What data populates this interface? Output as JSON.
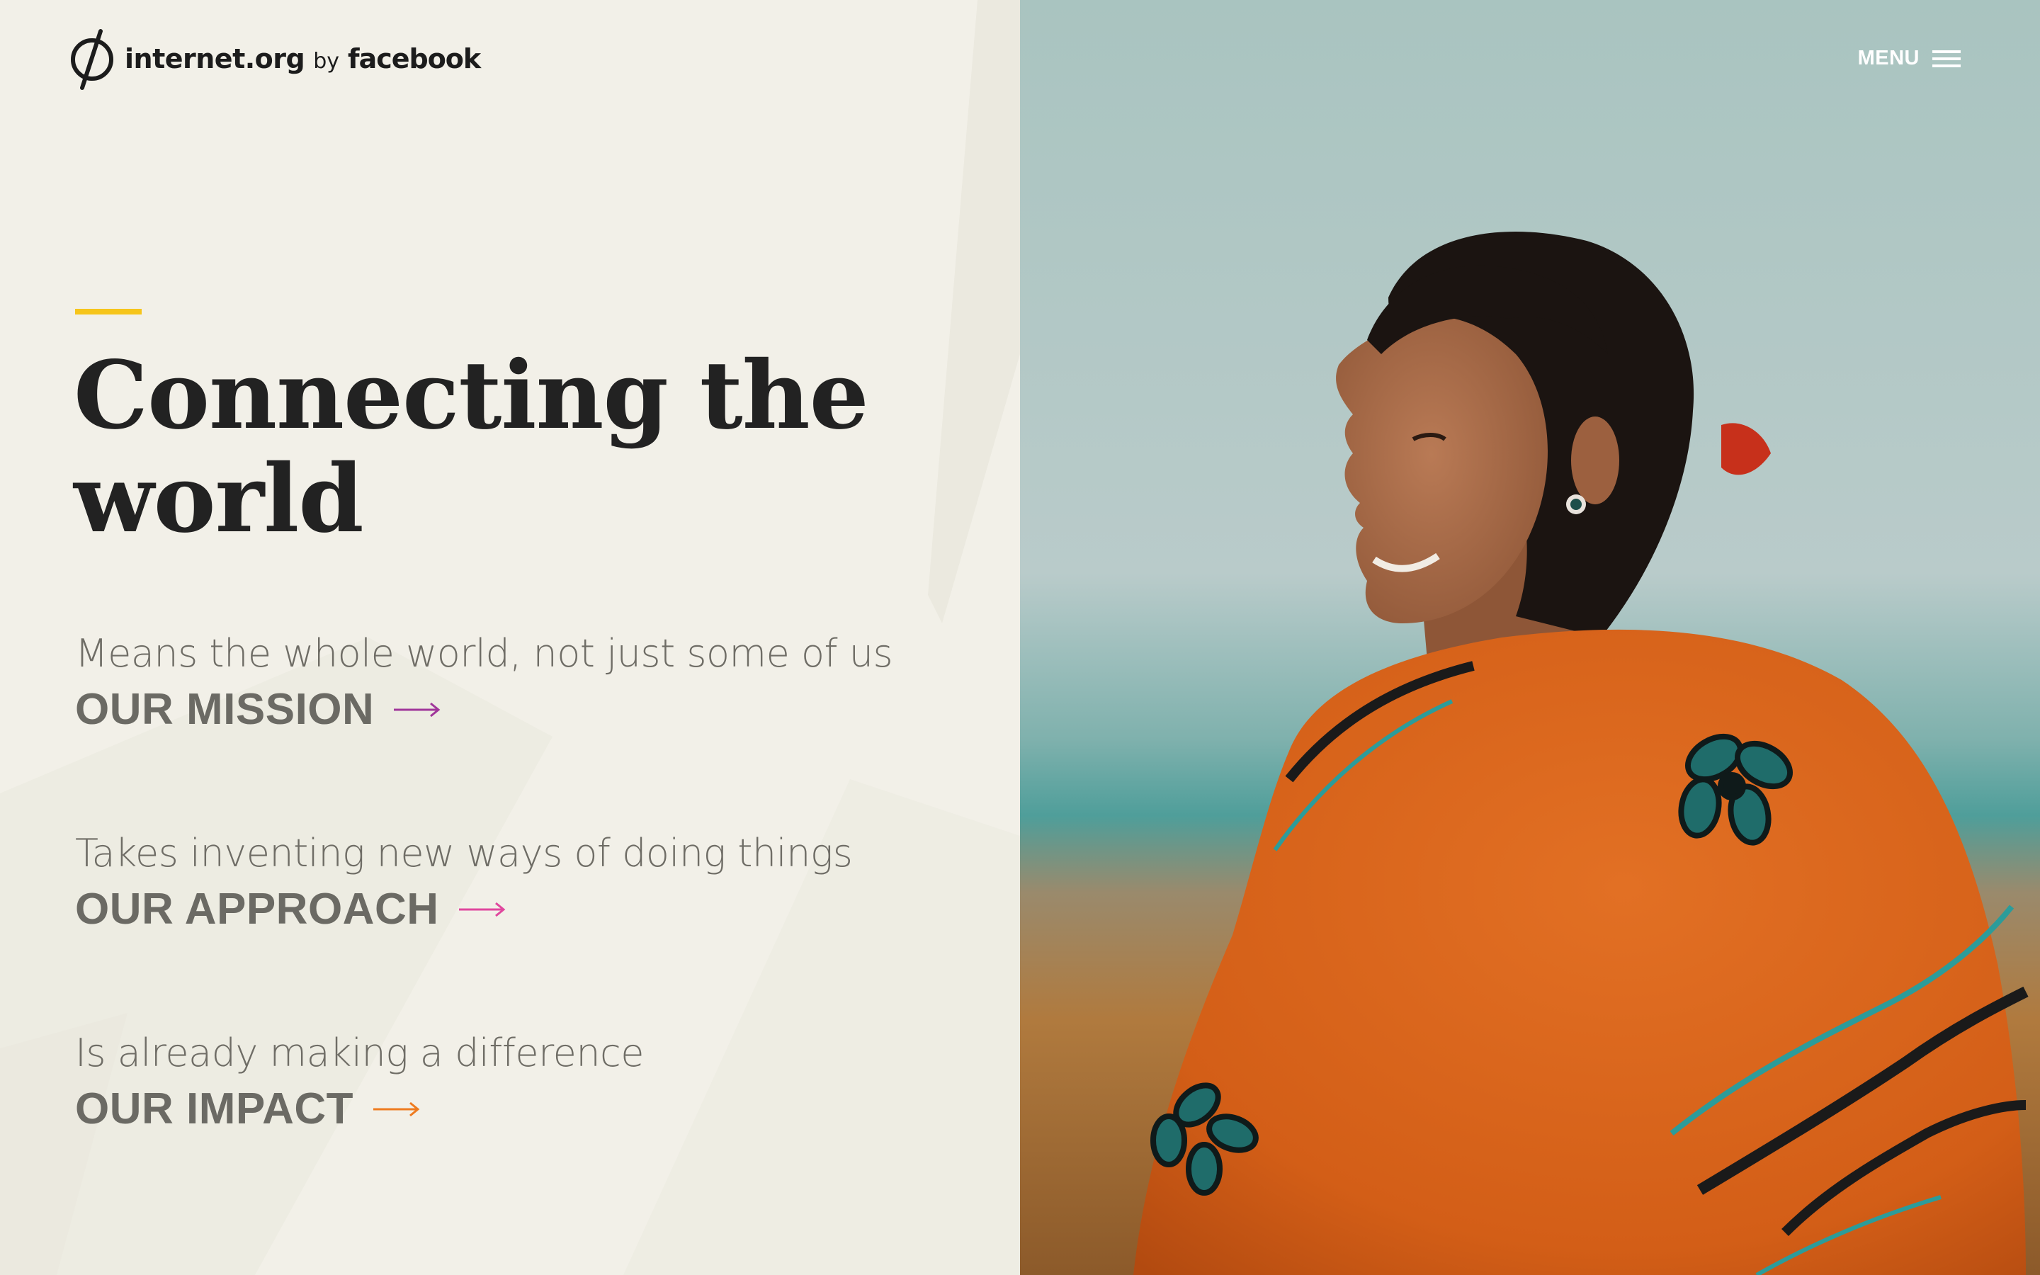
{
  "header": {
    "brand": "internet.org",
    "by": "by",
    "parent_brand": "facebook",
    "menu_label": "MENU"
  },
  "hero": {
    "headline_line1": "Connecting the",
    "headline_line2": "world",
    "accent_color": "#f6c51b"
  },
  "sections": [
    {
      "description": "Means the whole world, not just some of us",
      "link_label": "OUR MISSION",
      "arrow_color": "#a0369a"
    },
    {
      "description": "Takes inventing new ways of doing things",
      "link_label": "OUR APPROACH",
      "arrow_color": "#e0479e"
    },
    {
      "description": "Is already making a difference",
      "link_label": "OUR IMPACT",
      "arrow_color": "#ee7b1f"
    }
  ],
  "icons": {
    "logo": "internet-org-logo-icon",
    "menu": "hamburger-icon",
    "arrow": "arrow-right-icon"
  },
  "colors": {
    "left_background": "#f2f0e8",
    "headline": "#222222",
    "muted_text": "#6f6d66",
    "shawl_orange": "#d9651a"
  }
}
